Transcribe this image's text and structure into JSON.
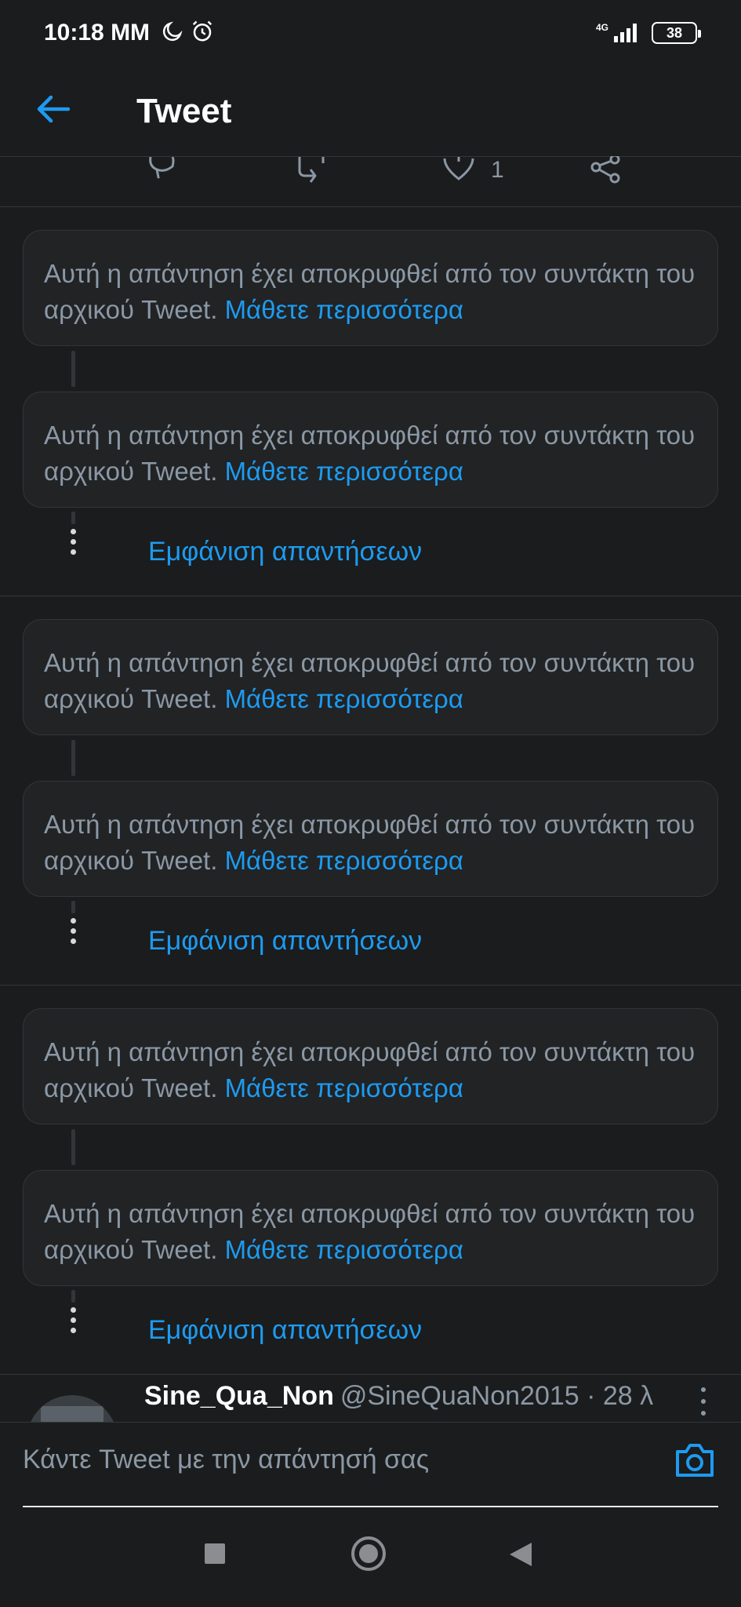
{
  "status_bar": {
    "time": "10:18 ΜΜ",
    "network": "4G",
    "battery": "38"
  },
  "header": {
    "title": "Tweet"
  },
  "actions": {
    "like_count": "1"
  },
  "hidden_reply": {
    "text": "Αυτή η απάντηση έχει αποκρυφθεί από τον συντάκτη του αρχικού Tweet.",
    "learn_more": "Μάθετε περισσότερα"
  },
  "groups": [
    {
      "show_replies": "Εμφάνιση απαντήσεων",
      "replies": [
        {
          "text": "Αυτή η απάντηση έχει αποκρυφθεί από τον συντάκτη του αρχικού Tweet.",
          "learn_more": "Μάθετε περισσότερα"
        },
        {
          "text": "Αυτή η απάντηση έχει αποκρυφθεί από τον συντάκτη του αρχικού Tweet.",
          "learn_more": "Μάθετε περισσότερα"
        }
      ]
    },
    {
      "show_replies": "Εμφάνιση απαντήσεων",
      "replies": [
        {
          "text": "Αυτή η απάντηση έχει αποκρυφθεί από τον συντάκτη του αρχικού Tweet.",
          "learn_more": "Μάθετε περισσότερα"
        },
        {
          "text": "Αυτή η απάντηση έχει αποκρυφθεί από τον συντάκτη του αρχικού Tweet.",
          "learn_more": "Μάθετε περισσότερα"
        }
      ]
    },
    {
      "show_replies": "Εμφάνιση απαντήσεων",
      "replies": [
        {
          "text": "Αυτή η απάντηση έχει αποκρυφθεί από τον συντάκτη του αρχικού Tweet.",
          "learn_more": "Μάθετε περισσότερα"
        },
        {
          "text": "Αυτή η απάντηση έχει αποκρυφθεί από τον συντάκτη του αρχικού Tweet.",
          "learn_more": "Μάθετε περισσότερα"
        }
      ]
    }
  ],
  "tweet_preview": {
    "display_name": "Sine_Qua_Non",
    "meta": "@SineQuaNon2015 · 28 λ"
  },
  "composer": {
    "placeholder": "Κάντε Tweet με την απάντησή σας"
  },
  "colors": {
    "accent": "#1d9bf0",
    "background": "#1b1c1d",
    "card": "#212325",
    "muted_text": "#8b98a5"
  }
}
